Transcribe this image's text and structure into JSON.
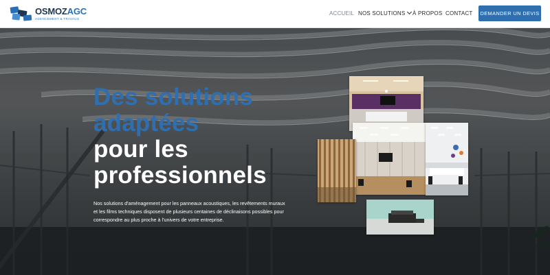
{
  "brand": {
    "name_part1": "OSMOZ",
    "name_part2": "AGC",
    "tagline": "AGENCEMENT & TRAVAUX",
    "colors": {
      "primary": "#2f6fb0",
      "dark": "#1f3550"
    }
  },
  "nav": {
    "items": [
      {
        "label": "ACCUEIL",
        "active": true
      },
      {
        "label": "NOS SOLUTIONS",
        "has_dropdown": true,
        "icon": "chevron-down-icon"
      },
      {
        "label": "À PROPOS"
      },
      {
        "label": "CONTACT"
      }
    ],
    "cta_label": "DEMANDER UN DEVIS"
  },
  "hero": {
    "headline_blue_1": "Des solutions",
    "headline_blue_2": "adaptées",
    "headline_white_1": "pour les",
    "headline_white_2": "professionnels",
    "description": "Nos solutions d'aménagement pour les panneaux acoustiques, les revêtements muraux et les films techniques disposent de plusieurs centaines de déclinaisons possibles pour correspondre au plus proche à l'univers de votre entreprise."
  }
}
